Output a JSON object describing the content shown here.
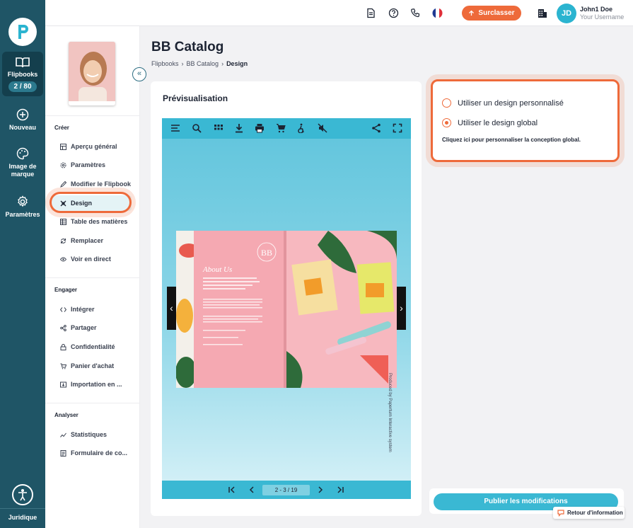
{
  "rail": {
    "items": [
      {
        "label": "Flipbooks",
        "badge": "2 / 80",
        "icon": "book-open-icon"
      },
      {
        "label": "Nouveau",
        "icon": "plus-circle-icon"
      },
      {
        "label": "Image de marque",
        "icon": "palette-icon"
      },
      {
        "label": "Paramètres",
        "icon": "gear-icon"
      }
    ],
    "legal": "Juridique"
  },
  "header": {
    "upgrade_label": "Surclasser",
    "avatar_initials": "JD",
    "user_name": "John1 Doe",
    "user_sub": "Your Username"
  },
  "nav": {
    "sections": [
      {
        "title": "Créer",
        "items": [
          {
            "label": "Aperçu général",
            "icon": "overview-icon"
          },
          {
            "label": "Paramètres",
            "icon": "gear-icon"
          },
          {
            "label": "Modifier le Flipbook",
            "icon": "pencil-icon"
          },
          {
            "label": "Design",
            "icon": "design-icon",
            "active": true
          },
          {
            "label": "Table des matières",
            "icon": "table-icon"
          },
          {
            "label": "Remplacer",
            "icon": "refresh-icon"
          },
          {
            "label": "Voir en direct",
            "icon": "eye-icon"
          }
        ]
      },
      {
        "title": "Engager",
        "items": [
          {
            "label": "Intégrer",
            "icon": "code-icon"
          },
          {
            "label": "Partager",
            "icon": "share-icon"
          },
          {
            "label": "Confidentialité",
            "icon": "lock-icon"
          },
          {
            "label": "Panier d'achat",
            "icon": "cart-icon"
          },
          {
            "label": "Importation en ...",
            "icon": "import-icon"
          }
        ]
      },
      {
        "title": "Analyser",
        "items": [
          {
            "label": "Statistiques",
            "icon": "chart-icon"
          },
          {
            "label": "Formulaire de co...",
            "icon": "form-icon"
          }
        ]
      }
    ]
  },
  "page": {
    "title": "BB Catalog",
    "breadcrumb": [
      "Flipbooks",
      "BB Catalog",
      "Design"
    ]
  },
  "preview": {
    "title": "Prévisualisation",
    "page_indicator": "2 - 3 / 19",
    "watermark": "Produced by Paperturn Interactive system",
    "book": {
      "monogram": "BB",
      "heading": "About Us"
    }
  },
  "design_options": {
    "options": [
      {
        "label": "Utiliser un design personnalisé",
        "selected": false
      },
      {
        "label": "Utiliser le design global",
        "selected": true
      }
    ],
    "hint": "Cliquez ici pour personnaliser la conception global."
  },
  "publish_label": "Publier les modifications",
  "feedback_label": "Retour d'information",
  "colors": {
    "accent": "#ee6a3a",
    "primary": "#3ab8d3",
    "rail": "#1f5566"
  }
}
